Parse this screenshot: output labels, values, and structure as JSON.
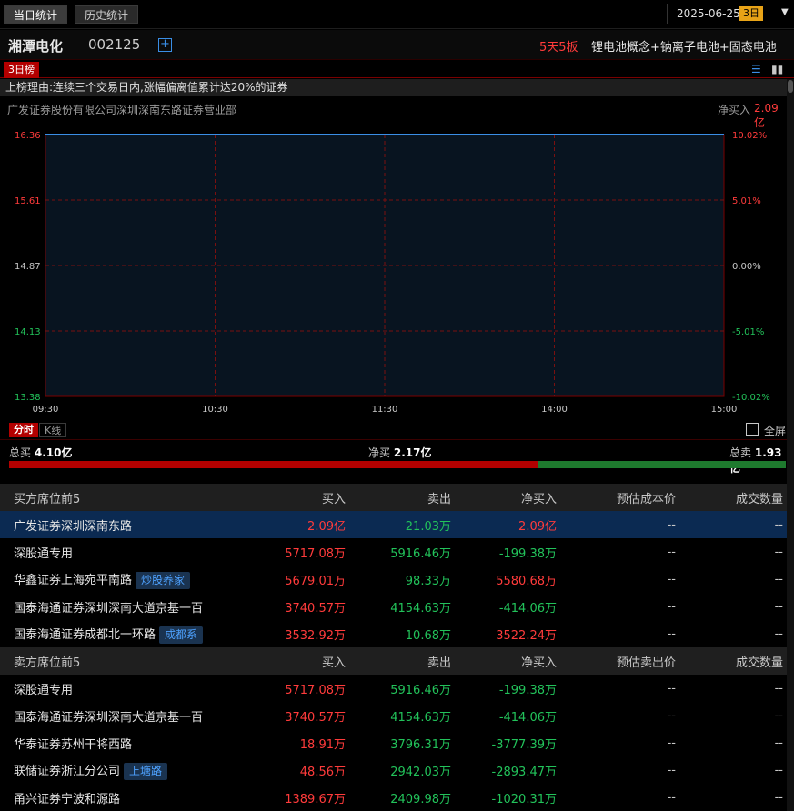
{
  "tabs": [
    "当日统计",
    "历史统计"
  ],
  "date": {
    "value": "2025-06-25",
    "badge": "3日"
  },
  "stock": {
    "name": "湘潭电化",
    "code": "002125",
    "streak": "5天5板",
    "concept": "锂电池概念+钠离子电池+固态电池"
  },
  "rank_badge": "3日榜",
  "reason": "上榜理由:连续三个交易日内,涨幅偏离值累计达20%的证券",
  "broker": {
    "name": "广发证券股份有限公司深圳深南东路证券营业部",
    "net_label": "净买入",
    "net_value": "2.09亿"
  },
  "chart_data": {
    "type": "line",
    "x_ticks": [
      "09:30",
      "10:30",
      "11:30",
      "14:00",
      "15:00"
    ],
    "y_ticks": [
      "16.36",
      "15.61",
      "14.87",
      "14.13",
      "13.38"
    ],
    "pct_ticks": [
      "10.02%",
      "5.01%",
      "0.00%",
      "-5.01%",
      "-10.02%"
    ],
    "ylim": [
      13.38,
      16.36
    ],
    "x": [
      "09:30",
      "15:00"
    ],
    "y": [
      16.36,
      16.36
    ],
    "colors": {
      "line": "#3a8ee6",
      "up": "#ff3b3b",
      "down": "#22c25a"
    }
  },
  "chart_tabs": [
    "分时",
    "K线"
  ],
  "fullscreen_label": "全屏",
  "totals": {
    "buy_label": "总买",
    "buy_value": "4.10亿",
    "net_label": "净买",
    "net_value": "2.17亿",
    "sell_label": "总卖",
    "sell_value": "1.93亿",
    "buy_ratio": 0.68
  },
  "buy_table": {
    "headers": [
      "买方席位前5",
      "买入",
      "卖出",
      "净买入",
      "预估成本价",
      "成交数量"
    ],
    "rows": [
      {
        "name": "广发证券深圳深南东路",
        "tag": "",
        "buy": "2.09亿",
        "sell": "21.03万",
        "net": "2.09亿",
        "cost": "--",
        "qty": "--"
      },
      {
        "name": "深股通专用",
        "tag": "",
        "buy": "5717.08万",
        "sell": "5916.46万",
        "net": "-199.38万",
        "cost": "--",
        "qty": "--"
      },
      {
        "name": "华鑫证券上海宛平南路",
        "tag": "炒股养家",
        "buy": "5679.01万",
        "sell": "98.33万",
        "net": "5580.68万",
        "cost": "--",
        "qty": "--"
      },
      {
        "name": "国泰海通证券深圳深南大道京基一百",
        "tag": "",
        "buy": "3740.57万",
        "sell": "4154.63万",
        "net": "-414.06万",
        "cost": "--",
        "qty": "--"
      },
      {
        "name": "国泰海通证券成都北一环路",
        "tag": "成都系",
        "buy": "3532.92万",
        "sell": "10.68万",
        "net": "3522.24万",
        "cost": "--",
        "qty": "--"
      }
    ]
  },
  "sell_table": {
    "headers": [
      "卖方席位前5",
      "买入",
      "卖出",
      "净买入",
      "预估卖出价",
      "成交数量"
    ],
    "rows": [
      {
        "name": "深股通专用",
        "tag": "",
        "buy": "5717.08万",
        "sell": "5916.46万",
        "net": "-199.38万",
        "cost": "--",
        "qty": "--"
      },
      {
        "name": "国泰海通证券深圳深南大道京基一百",
        "tag": "",
        "buy": "3740.57万",
        "sell": "4154.63万",
        "net": "-414.06万",
        "cost": "--",
        "qty": "--"
      },
      {
        "name": "华泰证券苏州干将西路",
        "tag": "",
        "buy": "18.91万",
        "sell": "3796.31万",
        "net": "-3777.39万",
        "cost": "--",
        "qty": "--"
      },
      {
        "name": "联储证券浙江分公司",
        "tag": "上塘路",
        "buy": "48.56万",
        "sell": "2942.03万",
        "net": "-2893.47万",
        "cost": "--",
        "qty": "--"
      },
      {
        "name": "甬兴证券宁波和源路",
        "tag": "",
        "buy": "1389.67万",
        "sell": "2409.98万",
        "net": "-1020.31万",
        "cost": "--",
        "qty": "--"
      }
    ]
  }
}
